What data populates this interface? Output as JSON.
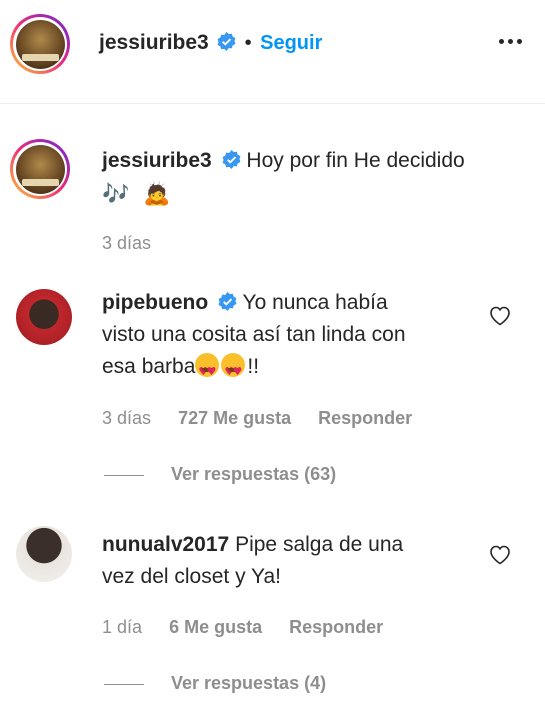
{
  "header": {
    "username": "jessiuribe3",
    "separator": "•",
    "follow_label": "Seguir"
  },
  "caption": {
    "username": "jessiuribe3",
    "text": "Hoy por fin He decidido",
    "emojis": [
      "🎶",
      "🙇"
    ],
    "time": "3 días"
  },
  "comments": [
    {
      "username": "pipebueno",
      "verified": true,
      "text_line1": "Yo nunca había",
      "text_line2": "visto una cosita así tan linda con",
      "text_line3_prefix": "esa barba",
      "text_line3_suffix": "!!",
      "time": "3 días",
      "likes": "727 Me gusta",
      "reply_label": "Responder",
      "view_replies": "Ver respuestas (63)"
    },
    {
      "username": "nunualv2017",
      "verified": false,
      "text_line1": "Pipe salga de una",
      "text_line2": "vez del closet y Ya!",
      "time": "1 día",
      "likes": "6 Me gusta",
      "reply_label": "Responder",
      "view_replies": "Ver respuestas (4)"
    }
  ],
  "colors": {
    "accent": "#0095f6",
    "verified": "#3897f0",
    "muted": "#8e8e8e",
    "text": "#262626"
  }
}
